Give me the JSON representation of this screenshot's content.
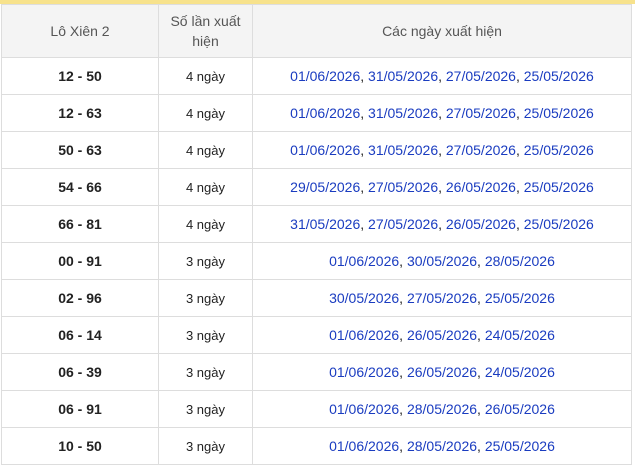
{
  "headers": {
    "pair": "Lô Xiên 2",
    "count_line1": "Số lần xuất",
    "count_line2": "hiện",
    "dates": "Các ngày xuất hiện"
  },
  "rows": [
    {
      "pair": "12 - 50",
      "count": "4 ngày",
      "dates": [
        "01/06/2026",
        "31/05/2026",
        "27/05/2026",
        "25/05/2026"
      ]
    },
    {
      "pair": "12 - 63",
      "count": "4 ngày",
      "dates": [
        "01/06/2026",
        "31/05/2026",
        "27/05/2026",
        "25/05/2026"
      ]
    },
    {
      "pair": "50 - 63",
      "count": "4 ngày",
      "dates": [
        "01/06/2026",
        "31/05/2026",
        "27/05/2026",
        "25/05/2026"
      ]
    },
    {
      "pair": "54 - 66",
      "count": "4 ngày",
      "dates": [
        "29/05/2026",
        "27/05/2026",
        "26/05/2026",
        "25/05/2026"
      ]
    },
    {
      "pair": "66 - 81",
      "count": "4 ngày",
      "dates": [
        "31/05/2026",
        "27/05/2026",
        "26/05/2026",
        "25/05/2026"
      ]
    },
    {
      "pair": "00 - 91",
      "count": "3 ngày",
      "dates": [
        "01/06/2026",
        "30/05/2026",
        "28/05/2026"
      ]
    },
    {
      "pair": "02 - 96",
      "count": "3 ngày",
      "dates": [
        "30/05/2026",
        "27/05/2026",
        "25/05/2026"
      ]
    },
    {
      "pair": "06 - 14",
      "count": "3 ngày",
      "dates": [
        "01/06/2026",
        "26/05/2026",
        "24/05/2026"
      ]
    },
    {
      "pair": "06 - 39",
      "count": "3 ngày",
      "dates": [
        "01/06/2026",
        "26/05/2026",
        "24/05/2026"
      ]
    },
    {
      "pair": "06 - 91",
      "count": "3 ngày",
      "dates": [
        "01/06/2026",
        "28/05/2026",
        "26/05/2026"
      ]
    },
    {
      "pair": "10 - 50",
      "count": "3 ngày",
      "dates": [
        "01/06/2026",
        "28/05/2026",
        "25/05/2026"
      ]
    }
  ],
  "colors": {
    "date_link": "#1a3cc0",
    "header_bg": "#f4f4f4",
    "top_bar": "#f7e28c",
    "border": "#dddddd"
  }
}
